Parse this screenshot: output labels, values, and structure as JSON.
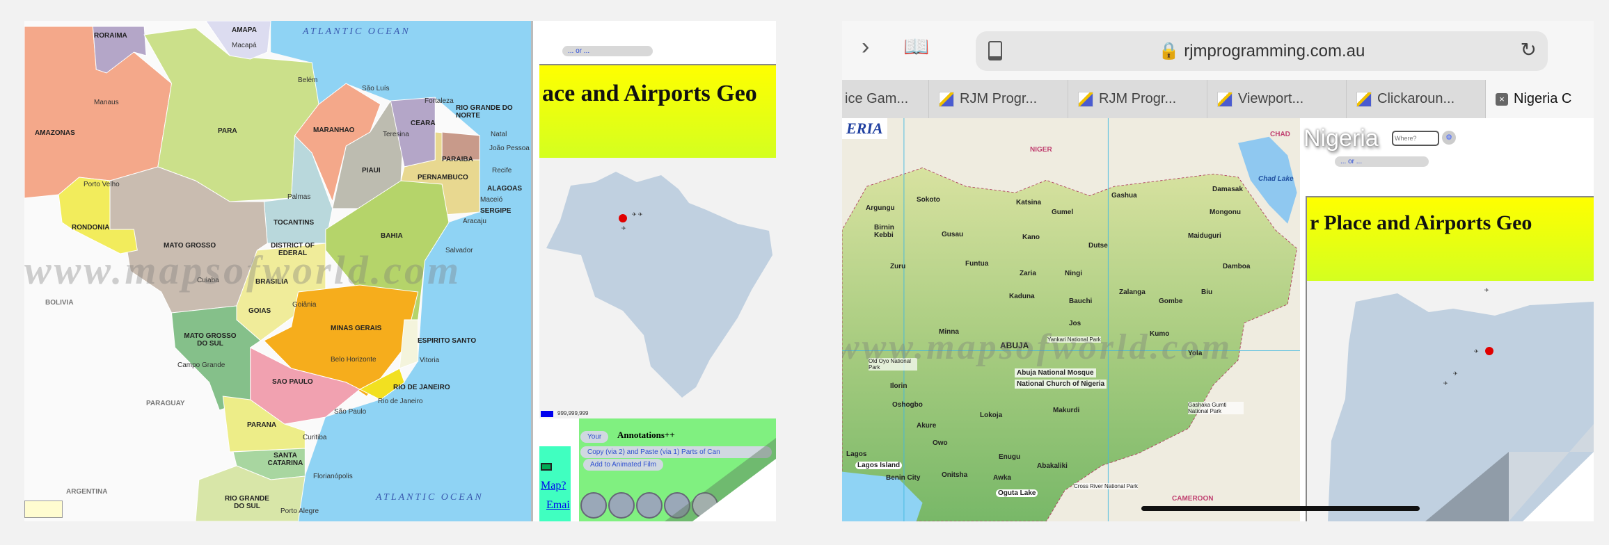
{
  "left": {
    "map_labels": [
      "RORAIMA",
      "AMAPA",
      "AMAZONAS",
      "PARA",
      "MARANHAO",
      "CEARA",
      "RIO GRANDE DO NORTE",
      "PIAUI",
      "PARAIBA",
      "PERNAMBUCO",
      "ALAGOAS",
      "SERGIPE",
      "TOCANTINS",
      "RONDONIA",
      "MATO GROSSO",
      "BAHIA",
      "DISTRICT OF EDERAL",
      "BRASILIA",
      "GOIAS",
      "MINAS GERAIS",
      "ESPIRITO SANTO",
      "MATO GROSSO DO SUL",
      "SAO PAULO",
      "RIO DE JANEIRO",
      "PARANA",
      "SANTA CATARINA",
      "RIO GRANDE DO SUL",
      "BOLIVIA",
      "PARAGUAY",
      "ARGENTINA"
    ],
    "cities": [
      "Macapá",
      "Belém",
      "São Luís",
      "Fortaleza",
      "Manaus",
      "Teresina",
      "Natal",
      "João Pessoa",
      "Recife",
      "Porto Velho",
      "Maceió",
      "Aracaju",
      "Palmas",
      "Salvador",
      "Cuiaba",
      "Goiânia",
      "Belo Horizonte",
      "Campo Grande",
      "Vitoria",
      "Rio de Janeiro",
      "São Paulo",
      "Curitiba",
      "Florianópolis",
      "Porto Alegre"
    ],
    "ocean_top": "ATLANTIC OCEAN",
    "ocean_bottom": "ATLANTIC OCEAN",
    "watermark": "www.mapsofworld.com",
    "select_value": "... or ...",
    "banner_title": "ace and Airports Geo",
    "legend_value": "999,999,999",
    "annotation_select": "Your",
    "annotations_title": "Annotations++",
    "copy_button": "Copy (via 2) and Paste (via 1) Parts of Can",
    "add_film_button": "Add to Animated Film",
    "map_link": "Map?",
    "email_link": "Emai"
  },
  "right": {
    "url": "rjmprogramming.com.au",
    "tabs": [
      {
        "label": "ice Gam...",
        "icon": "none"
      },
      {
        "label": "RJM Progr...",
        "icon": "rjm-favicon"
      },
      {
        "label": "RJM Progr...",
        "icon": "rjm-favicon"
      },
      {
        "label": "Viewport...",
        "icon": "rjm-favicon"
      },
      {
        "label": "Clickaroun...",
        "icon": "rjm-favicon"
      },
      {
        "label": "Nigeria C",
        "icon": "close-tab",
        "active": true
      }
    ],
    "map_title": "ERIA",
    "map_labels": [
      "NIGER",
      "CHAD",
      "Chad Lake",
      "CAMEROON",
      "Sokoto",
      "Katsina",
      "Argungu",
      "Birnin Kebbi",
      "Gusau",
      "Kano",
      "Gumel",
      "Gashua",
      "Damasak",
      "Mongonu",
      "Maiduguri",
      "Dutse",
      "Zuru",
      "Funtua",
      "Zaria",
      "Ningi",
      "Damboa",
      "Kaduna",
      "Bauchi",
      "Zalanga",
      "Gombe",
      "Biu",
      "Jos",
      "Kumo",
      "Minna",
      "ABUJA",
      "Yola",
      "Ilorin",
      "Oshogbo",
      "Lokoja",
      "Makurdi",
      "Akure",
      "Owo",
      "Lagos",
      "Lagos Island",
      "Benin City",
      "Onitsha",
      "Enugu",
      "Awka",
      "Oguta Lake",
      "Abakaliki"
    ],
    "callouts": [
      "Abuja National Mosque",
      "National Church of Nigeria",
      "Yankari National Park",
      "Old Oyo National Park",
      "Gashaka Gumti National Park",
      "Cross River National Park"
    ],
    "watermark": "www.mapsofworld.com",
    "country_title": "Nigeria",
    "where_placeholder": "Where?",
    "select_value": "... or ...",
    "banner_title": "r Place and Airports Geo"
  },
  "colors": {
    "banner_top": "#ffff00",
    "banner_bottom": "#d4ff20",
    "ocean": "#8fd3f4",
    "marker": "#e00000",
    "annotation_panel": "#80f080",
    "map_fill": "#c0d0e0"
  }
}
